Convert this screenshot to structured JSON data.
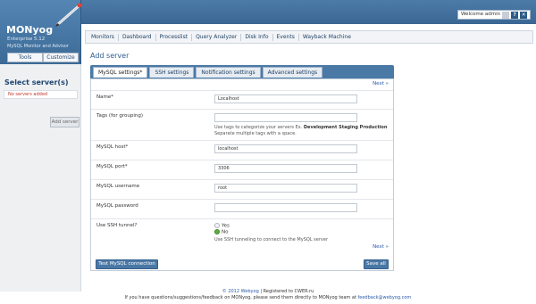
{
  "brand": {
    "title": "MONyog",
    "version": "Enterprise 5.12",
    "subtitle": "MySQL Monitor and Advisor",
    "tools_label": "Tools",
    "customize_label": "Customize"
  },
  "header": {
    "welcome": "Welcome admin",
    "help_label": "?"
  },
  "nav": {
    "items": [
      "Monitors",
      "Dashboard",
      "Processlist",
      "Query Analyzer",
      "Disk Info",
      "Events",
      "Wayback Machine"
    ]
  },
  "sidebar": {
    "title": "Select server(s)",
    "empty_message": "No servers added",
    "add_server_label": "Add server"
  },
  "main": {
    "title": "Add server",
    "tabs": [
      "MySQL settings*",
      "SSH settings",
      "Notification settings",
      "Advanced settings"
    ],
    "next_label": "Next »",
    "form": {
      "name_label": "Name*",
      "name_value": "Localhost",
      "tags_label": "Tags (for grouping)",
      "tags_value": "",
      "tags_help_prefix": "Use tags to categorize your servers Ex.",
      "tags_help_bold": "Development Staging Production",
      "tags_help_line2": "Separate multiple tags with a space.",
      "host_label": "MySQL host*",
      "host_value": "localhost",
      "port_label": "MySQL port*",
      "port_value": "3306",
      "user_label": "MySQL username",
      "user_value": "root",
      "password_label": "MySQL password",
      "password_value": "",
      "ssh_label": "Use SSH tunnel?",
      "ssh_yes": "Yes",
      "ssh_no": "No",
      "ssh_selected": "No",
      "ssh_help": "Use SSH tunneling to connect to the MySQL server"
    },
    "test_button": "Test MySQL connection",
    "save_button": "Save all"
  },
  "footer": {
    "copyright_prefix": "© 2012",
    "copyright_link": "Webyog",
    "copyright_suffix": "| Registered to CWER.ru",
    "line2_prefix": "If you have questions/suggestions/feedback on MONyog, please send them directly to MONyog team at",
    "email": "feedback@webyog.com"
  },
  "colors": {
    "header": "#3f6d99",
    "accent": "#4a78a6",
    "link": "#2a5aa8",
    "error": "#c0392b",
    "radio_on": "#5fae3c"
  }
}
